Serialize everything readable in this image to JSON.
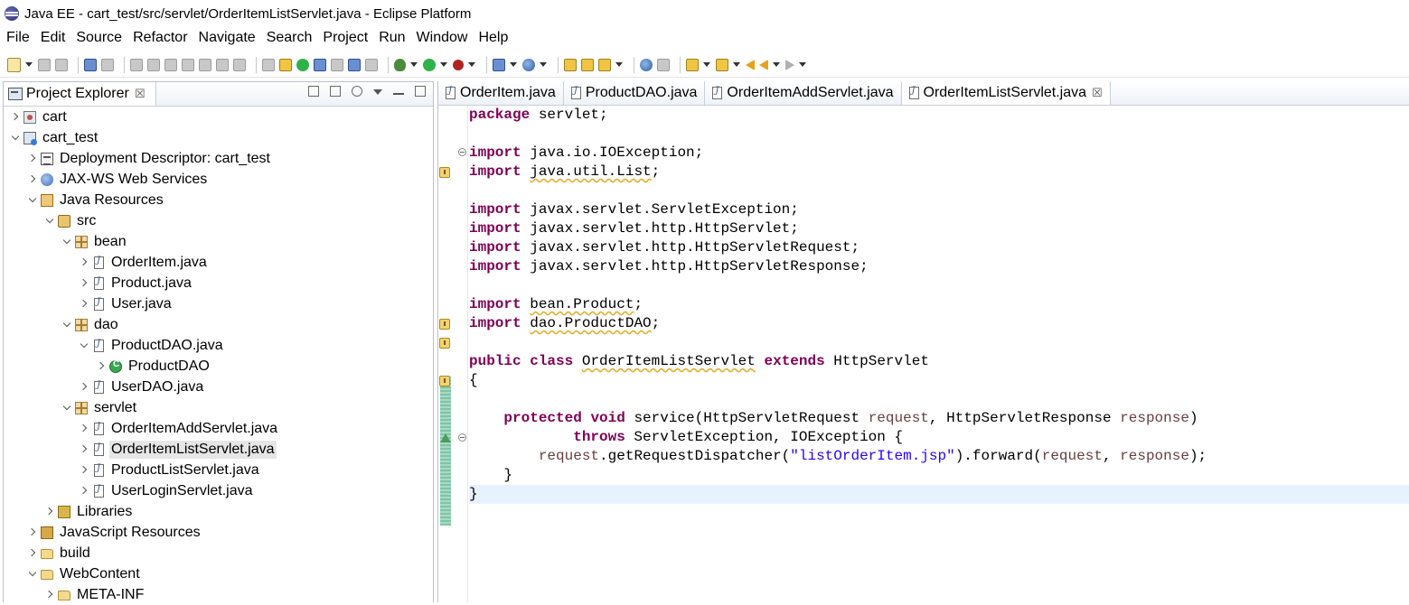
{
  "window": {
    "title": "Java EE - cart_test/src/servlet/OrderItemListServlet.java - Eclipse Platform"
  },
  "menu": {
    "items": [
      "File",
      "Edit",
      "Source",
      "Refactor",
      "Navigate",
      "Search",
      "Project",
      "Run",
      "Window",
      "Help"
    ]
  },
  "toolbar": {
    "icons": [
      "new-icon",
      "save-icon",
      "save-all-icon",
      "terminal-icon",
      "skip-breakpoints-icon",
      "resume-icon",
      "suspend-icon",
      "terminate-icon",
      "disconnect-icon",
      "step-into-icon",
      "step-over-icon",
      "step-return-icon",
      "open-task-icon",
      "open-type-icon",
      "toggle-mark-icon",
      "highlight-icon",
      "hide-icon",
      "show-whitespace-icon",
      "debug-icon",
      "run-icon",
      "stop-server-icon",
      "new-server-icon",
      "new-webservice-icon",
      "open-folder-icon",
      "open-folder-2-icon",
      "pen-icon",
      "globe-icon",
      "search-icon",
      "next-annotation-icon",
      "prev-annotation-icon",
      "last-edit-icon",
      "back-icon",
      "forward-icon"
    ]
  },
  "project_explorer": {
    "title": "Project Explorer",
    "close_glyph": "☒",
    "tree": [
      {
        "label": "cart",
        "depth": 0,
        "state": "closed",
        "icon": "project-icon"
      },
      {
        "label": "cart_test",
        "depth": 0,
        "state": "open",
        "icon": "web-project-icon"
      },
      {
        "label": "Deployment Descriptor: cart_test",
        "depth": 1,
        "state": "closed",
        "icon": "deployment-descriptor-icon"
      },
      {
        "label": "JAX-WS Web Services",
        "depth": 1,
        "state": "closed",
        "icon": "jaxws-icon"
      },
      {
        "label": "Java Resources",
        "depth": 1,
        "state": "open",
        "icon": "java-resources-icon"
      },
      {
        "label": "src",
        "depth": 2,
        "state": "open",
        "icon": "source-folder-icon"
      },
      {
        "label": "bean",
        "depth": 3,
        "state": "open",
        "icon": "package-icon"
      },
      {
        "label": "OrderItem.java",
        "depth": 4,
        "state": "closed",
        "icon": "java-file-icon"
      },
      {
        "label": "Product.java",
        "depth": 4,
        "state": "closed",
        "icon": "java-file-icon"
      },
      {
        "label": "User.java",
        "depth": 4,
        "state": "closed",
        "icon": "java-file-icon"
      },
      {
        "label": "dao",
        "depth": 3,
        "state": "open",
        "icon": "package-icon"
      },
      {
        "label": "ProductDAO.java",
        "depth": 4,
        "state": "open",
        "icon": "java-file-icon"
      },
      {
        "label": "ProductDAO",
        "depth": 5,
        "state": "closed",
        "icon": "class-icon"
      },
      {
        "label": "UserDAO.java",
        "depth": 4,
        "state": "closed",
        "icon": "java-file-icon"
      },
      {
        "label": "servlet",
        "depth": 3,
        "state": "open",
        "icon": "package-icon"
      },
      {
        "label": "OrderItemAddServlet.java",
        "depth": 4,
        "state": "closed",
        "icon": "java-file-icon"
      },
      {
        "label": "OrderItemListServlet.java",
        "depth": 4,
        "state": "closed",
        "icon": "java-file-icon",
        "selected": true
      },
      {
        "label": "ProductListServlet.java",
        "depth": 4,
        "state": "closed",
        "icon": "java-file-icon"
      },
      {
        "label": "UserLoginServlet.java",
        "depth": 4,
        "state": "closed",
        "icon": "java-file-icon"
      },
      {
        "label": "Libraries",
        "depth": 2,
        "state": "closed",
        "icon": "libraries-icon"
      },
      {
        "label": "JavaScript Resources",
        "depth": 1,
        "state": "closed",
        "icon": "javascript-resources-icon"
      },
      {
        "label": "build",
        "depth": 1,
        "state": "closed",
        "icon": "folder-icon"
      },
      {
        "label": "WebContent",
        "depth": 1,
        "state": "open",
        "icon": "folder-icon"
      },
      {
        "label": "META-INF",
        "depth": 2,
        "state": "closed",
        "icon": "folder-icon"
      }
    ]
  },
  "editor": {
    "tabs": [
      {
        "label": "OrderItem.java",
        "active": false
      },
      {
        "label": "ProductDAO.java",
        "active": false
      },
      {
        "label": "OrderItemAddServlet.java",
        "active": false
      },
      {
        "label": "OrderItemListServlet.java",
        "active": true,
        "close_glyph": "☒"
      }
    ],
    "code_lines": [
      [
        {
          "t": "package",
          "c": "kw"
        },
        {
          "t": " servlet;"
        }
      ],
      [],
      [
        {
          "t": "import",
          "c": "kw"
        },
        {
          "t": " java.io.IOException;"
        }
      ],
      [
        {
          "t": "import",
          "c": "kw"
        },
        {
          "t": " "
        },
        {
          "t": "java.util.List",
          "c": "warn-underline"
        },
        {
          "t": ";"
        }
      ],
      [],
      [
        {
          "t": "import",
          "c": "kw"
        },
        {
          "t": " javax.servlet.ServletException;"
        }
      ],
      [
        {
          "t": "import",
          "c": "kw"
        },
        {
          "t": " javax.servlet.http.HttpServlet;"
        }
      ],
      [
        {
          "t": "import",
          "c": "kw"
        },
        {
          "t": " javax.servlet.http.HttpServletRequest;"
        }
      ],
      [
        {
          "t": "import",
          "c": "kw"
        },
        {
          "t": " javax.servlet.http.HttpServletResponse;"
        }
      ],
      [],
      [
        {
          "t": "import",
          "c": "kw"
        },
        {
          "t": " "
        },
        {
          "t": "bean.Product",
          "c": "warn-underline"
        },
        {
          "t": ";"
        }
      ],
      [
        {
          "t": "import",
          "c": "kw"
        },
        {
          "t": " "
        },
        {
          "t": "dao.ProductDAO",
          "c": "warn-underline"
        },
        {
          "t": ";"
        }
      ],
      [],
      [
        {
          "t": "public",
          "c": "kw"
        },
        {
          "t": " "
        },
        {
          "t": "class",
          "c": "kw"
        },
        {
          "t": " "
        },
        {
          "t": "OrderItemListServlet",
          "c": "warn-underline"
        },
        {
          "t": " "
        },
        {
          "t": "extends",
          "c": "kw"
        },
        {
          "t": " HttpServlet"
        }
      ],
      [
        {
          "t": "{"
        }
      ],
      [],
      [
        {
          "t": "    "
        },
        {
          "t": "protected",
          "c": "kw"
        },
        {
          "t": " "
        },
        {
          "t": "void",
          "c": "kw"
        },
        {
          "t": " service(HttpServletRequest "
        },
        {
          "t": "request",
          "c": "param"
        },
        {
          "t": ", HttpServletResponse "
        },
        {
          "t": "response",
          "c": "param"
        },
        {
          "t": ")"
        }
      ],
      [
        {
          "t": "            "
        },
        {
          "t": "throws",
          "c": "kw"
        },
        {
          "t": " ServletException, IOException {"
        }
      ],
      [
        {
          "t": "        "
        },
        {
          "t": "request",
          "c": "param"
        },
        {
          "t": ".getRequestDispatcher("
        },
        {
          "t": "\"listOrderItem.jsp\"",
          "c": "str"
        },
        {
          "t": ").forward("
        },
        {
          "t": "request",
          "c": "param"
        },
        {
          "t": ", "
        },
        {
          "t": "response",
          "c": "param"
        },
        {
          "t": ");"
        }
      ],
      [
        {
          "t": "    }"
        }
      ],
      [
        {
          "t": "}"
        }
      ],
      [],
      [],
      [],
      [],
      []
    ],
    "current_line_index": 20
  },
  "colors": {
    "keyword": "#7f0055",
    "string": "#2a00ff",
    "parameter": "#6a3e3e",
    "current_line": "#e8f2fe",
    "selection": "#e6e6e6"
  }
}
